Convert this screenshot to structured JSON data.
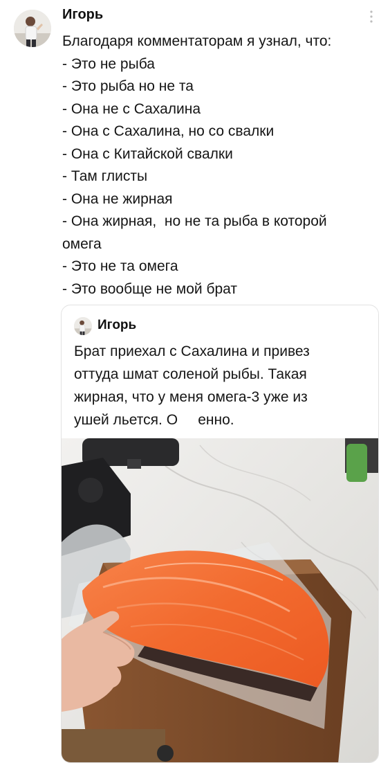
{
  "post": {
    "author": "Игорь",
    "more_icon": "vertical-ellipsis-icon",
    "lines": [
      "Благодаря комментаторам я узнал, что:",
      "- Это не рыба",
      "- Это рыба но не та",
      "- Она не с Сахалина",
      "- Она с Сахалина, но со свалки",
      "- Она с Китайской свалки",
      "- Там глисты",
      "- Она не жирная",
      "- Она жирная,  но не та рыба в которой",
      "омега",
      "- Это не та омега",
      "- Это вообще не мой брат"
    ]
  },
  "quoted_post": {
    "author": "Игорь",
    "lines": [
      "Брат приехал с Сахалина и привез",
      "оттуда шмат соленой рыбы. Такая",
      "жирная, что у меня омега-3 уже из",
      "ушей льется. О     енно."
    ],
    "photo_alt": "salted fish fillet on a cutting board"
  },
  "colors": {
    "text": "#151515",
    "muted": "#b5b5b5",
    "border": "#e2e2e2",
    "fish": "#f36a2c",
    "board": "#7a4a2a"
  }
}
